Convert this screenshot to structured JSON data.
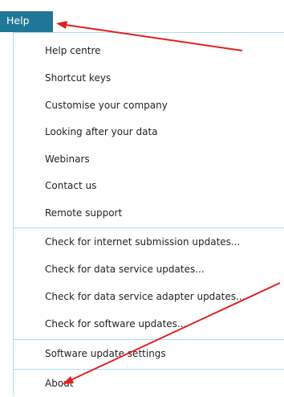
{
  "menu_bar": {
    "help_label": "Help"
  },
  "menu": {
    "group1": [
      "Help centre",
      "Shortcut keys",
      "Customise your company",
      "Looking after your data",
      "Webinars",
      "Contact us",
      "Remote support"
    ],
    "group2": [
      "Check for internet submission updates...",
      "Check for data service updates...",
      "Check for data service adapter updates...",
      "Check for software updates..."
    ],
    "group3": [
      "Software update settings"
    ],
    "group4": [
      "About"
    ]
  },
  "colors": {
    "accent": "#1f7897",
    "separator": "#a9dff0",
    "arrow": "#e02020"
  }
}
